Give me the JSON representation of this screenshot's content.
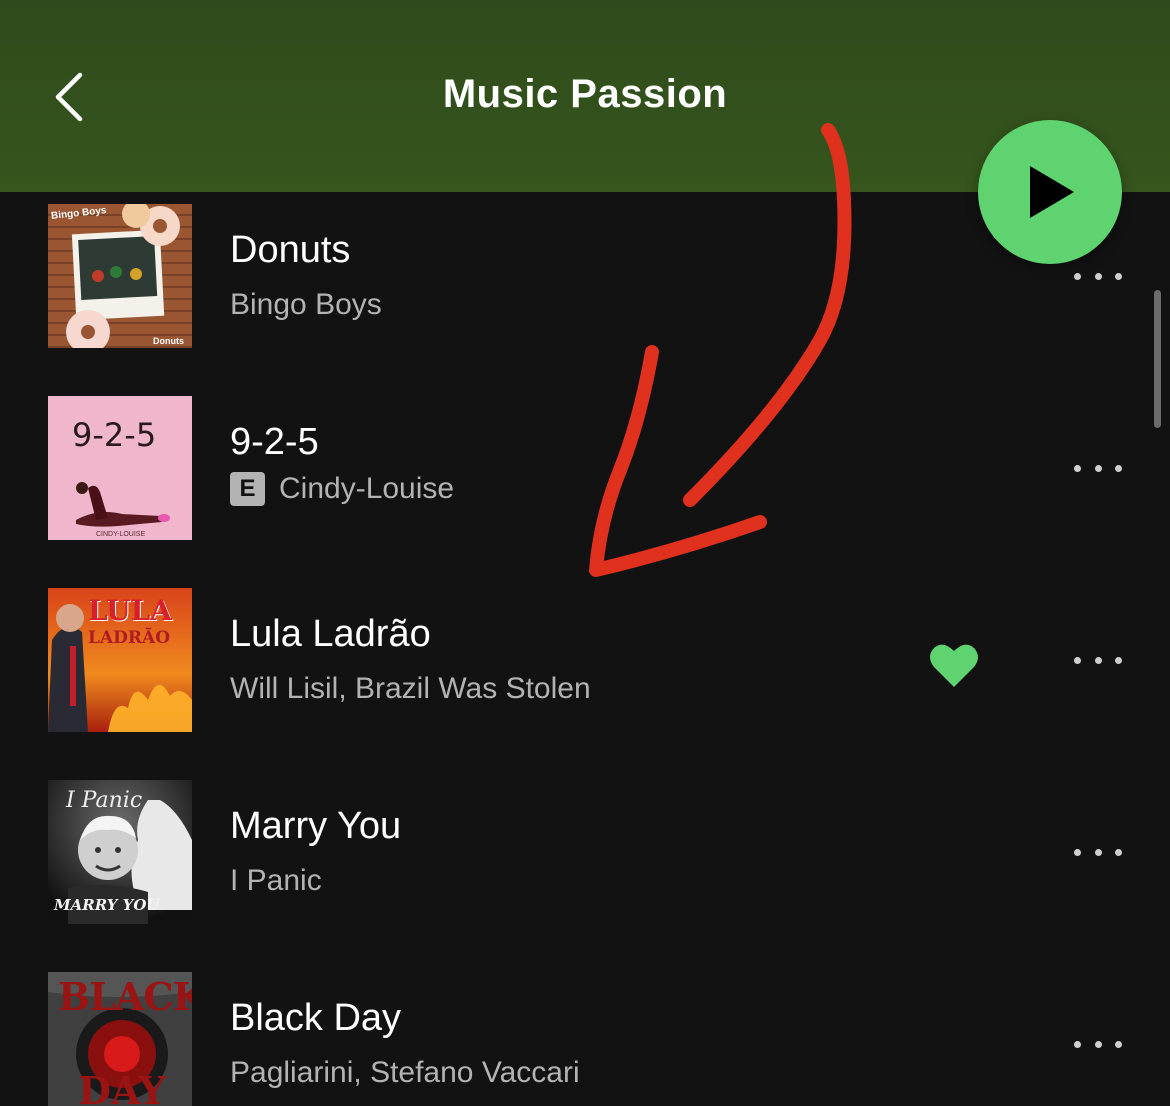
{
  "header": {
    "title": "Music Passion",
    "back_icon": "chevron-left-icon",
    "play_icon": "play-icon"
  },
  "colors": {
    "header_bg": "#33511c",
    "accent_green": "#5ed370",
    "background": "#121212",
    "secondary_text": "#b3b3b3",
    "annotation_red": "#e0301e"
  },
  "tracks": [
    {
      "title": "Donuts",
      "artist": "Bingo Boys",
      "explicit": false,
      "liked": false,
      "cover_text": [
        "Bingo Boys",
        "Donuts"
      ]
    },
    {
      "title": "9-2-5",
      "artist": "Cindy-Louise",
      "explicit": true,
      "explicit_label": "E",
      "liked": false,
      "cover_text": [
        "9-2-5",
        "CINDY-LOUISE"
      ]
    },
    {
      "title": "Lula Ladrão",
      "artist": "Will Lisil, Brazil Was Stolen",
      "explicit": false,
      "liked": true,
      "cover_text": [
        "LULA",
        "LADRÃO"
      ]
    },
    {
      "title": "Marry You",
      "artist": "I Panic",
      "explicit": false,
      "liked": false,
      "cover_text": [
        "I Panic",
        "MARRY YOU"
      ]
    },
    {
      "title": "Black Day",
      "artist": "Pagliarini, Stefano Vaccari",
      "explicit": false,
      "liked": false,
      "cover_text": [
        "BLACK",
        "DAY"
      ]
    }
  ]
}
